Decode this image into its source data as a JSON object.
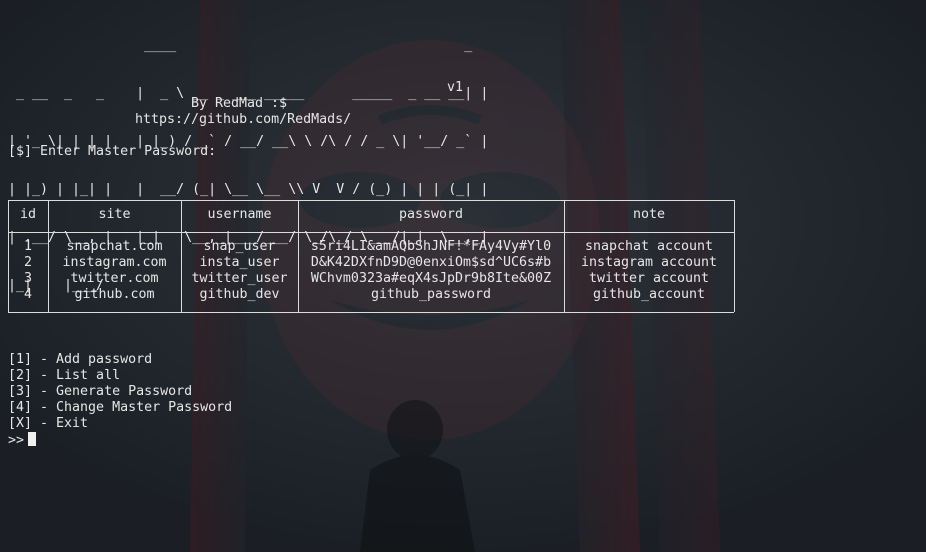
{
  "banner": {
    "ascii_lines": [
      "                 ____                                    _ ",
      " _ __  _   _    |  _ \\ __ _ ___ _____      _____  _ __ __| |",
      "| '_ \\| | | |   | |_) / _` / __/ __\\ \\ /\\ / / _ \\| '__/ _` |",
      "| |_) | |_| |   |  __/ (_| \\__ \\__ \\\\ V  V / (_) | | | (_| |",
      "| .__/ \\__, |   |_|   \\__,_|___/___/ \\_/\\_/ \\___/|_|  \\__,_|",
      "|_|    |___/                                               "
    ],
    "version": "v1",
    "author": "By RedMad :$",
    "url": "https://github.com/RedMads/"
  },
  "prompt_master": "[$] Enter Master Password:",
  "table": {
    "headers": [
      "id",
      "site",
      "username",
      "password",
      "note"
    ],
    "rows": [
      [
        "1",
        "snapchat.com",
        "snap_user",
        "s5ri4LI&amAQbShJNF!*FAy4Vy#Yl0",
        "snapchat account"
      ],
      [
        "2",
        "instagram.com",
        "insta_user",
        "D&K42DXfnD9D@0enxiOm$sd^UC6s#b",
        "instagram account"
      ],
      [
        "3",
        "twitter.com",
        "twitter_user",
        "WChvm0323a#eqX4sJpDr9b8Ite&00Z",
        "twitter account"
      ],
      [
        "4",
        "github.com",
        "github_dev",
        "github_password",
        "github_account"
      ]
    ]
  },
  "menu": [
    "[1] - Add password",
    "[2] - List all",
    "[3] - Generate Password",
    "[4] - Change Master Password",
    "[X] - Exit"
  ],
  "input_prompt": ">>",
  "colors": {
    "background": "#1e2329",
    "text": "#e6e6e6",
    "mask_red": "#7a1f2a"
  }
}
